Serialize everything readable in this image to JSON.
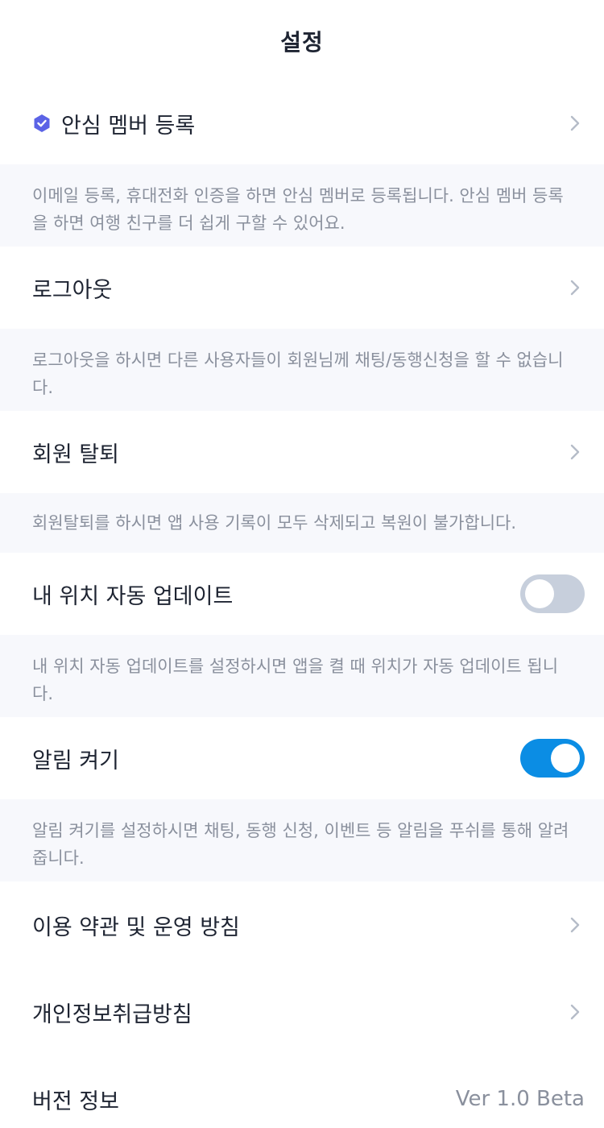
{
  "header": {
    "title": "설정"
  },
  "safe_member": {
    "label": "안심 멤버 등록",
    "icon": "verified-badge-icon",
    "desc": "이메일 등록, 휴대전화 인증을 하면 안심 멤버로 등록됩니다. 안심 멤버 등록을 하면 여행 친구를 더 쉽게 구할 수 있어요."
  },
  "logout": {
    "label": "로그아웃",
    "desc": "로그아웃을 하시면 다른 사용자들이 회원님께 채팅/동행신청을 할 수 없습니다."
  },
  "withdraw": {
    "label": "회원 탈퇴",
    "desc": "회원탈퇴를 하시면 앱 사용 기록이 모두 삭제되고 복원이 불가합니다."
  },
  "location_update": {
    "label": "내 위치 자동 업데이트",
    "enabled": false,
    "desc": "내 위치 자동 업데이트를 설정하시면 앱을 켤 때 위치가 자동 업데이트 됩니다."
  },
  "notifications": {
    "label": "알림 켜기",
    "enabled": true,
    "desc": "알림 켜기를 설정하시면 채팅, 동행 신청, 이벤트 등 알림을 푸쉬를 통해 알려줍니다."
  },
  "terms": {
    "label": "이용 약관 및 운영 방침"
  },
  "privacy": {
    "label": "개인정보취급방침"
  },
  "version": {
    "label": "버전 정보",
    "value": "Ver 1.0 Beta"
  },
  "colors": {
    "accent": "#0b8de4",
    "badge": "#5b63e6",
    "toggle_off": "#c7cfdc",
    "desc_bg": "#f7f8fc"
  }
}
